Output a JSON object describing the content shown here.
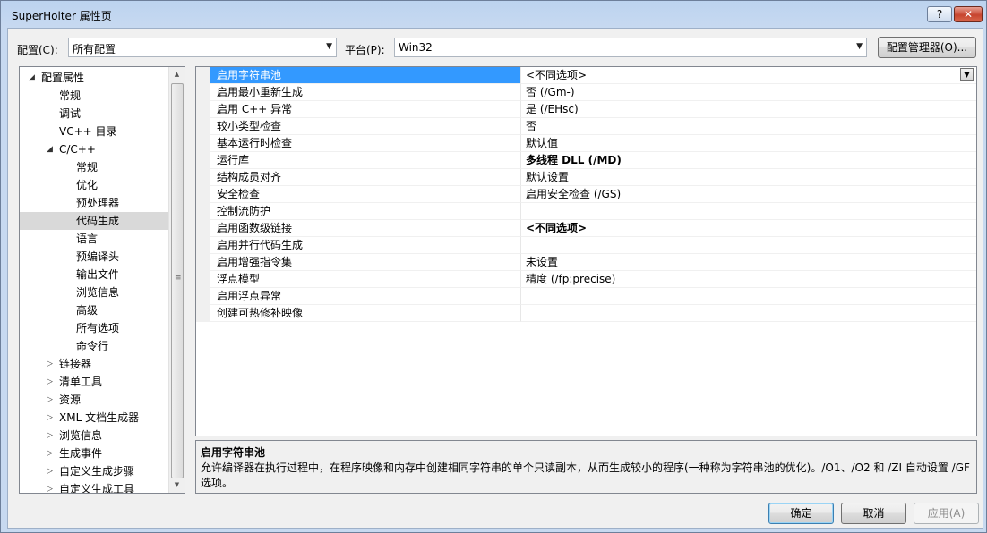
{
  "window": {
    "title": "SuperHolter 属性页",
    "help_label": "?",
    "close_label": "✕"
  },
  "header": {
    "config_label": "配置(C):",
    "config_value": "所有配置",
    "platform_label": "平台(P):",
    "platform_value": "Win32",
    "config_manager_label": "配置管理器(O)..."
  },
  "tree": {
    "items": [
      {
        "label": "配置属性",
        "expander": "◢",
        "level": 0
      },
      {
        "label": "常规",
        "expander": "",
        "level": 1
      },
      {
        "label": "调试",
        "expander": "",
        "level": 1
      },
      {
        "label": "VC++ 目录",
        "expander": "",
        "level": 1
      },
      {
        "label": "C/C++",
        "expander": "◢",
        "level": 1
      },
      {
        "label": "常规",
        "expander": "",
        "level": 2
      },
      {
        "label": "优化",
        "expander": "",
        "level": 2
      },
      {
        "label": "预处理器",
        "expander": "",
        "level": 2
      },
      {
        "label": "代码生成",
        "expander": "",
        "level": 2,
        "selected": true
      },
      {
        "label": "语言",
        "expander": "",
        "level": 2
      },
      {
        "label": "预编译头",
        "expander": "",
        "level": 2
      },
      {
        "label": "输出文件",
        "expander": "",
        "level": 2
      },
      {
        "label": "浏览信息",
        "expander": "",
        "level": 2
      },
      {
        "label": "高级",
        "expander": "",
        "level": 2
      },
      {
        "label": "所有选项",
        "expander": "",
        "level": 2
      },
      {
        "label": "命令行",
        "expander": "",
        "level": 2
      },
      {
        "label": "链接器",
        "expander": "▷",
        "level": 1
      },
      {
        "label": "清单工具",
        "expander": "▷",
        "level": 1
      },
      {
        "label": "资源",
        "expander": "▷",
        "level": 1
      },
      {
        "label": "XML 文档生成器",
        "expander": "▷",
        "level": 1
      },
      {
        "label": "浏览信息",
        "expander": "▷",
        "level": 1
      },
      {
        "label": "生成事件",
        "expander": "▷",
        "level": 1
      },
      {
        "label": "自定义生成步骤",
        "expander": "▷",
        "level": 1
      },
      {
        "label": "自定义生成工具",
        "expander": "▷",
        "level": 1
      }
    ],
    "scroll_up": "▲",
    "scroll_down": "▼",
    "grip": "≡"
  },
  "properties": {
    "rows": [
      {
        "name": "启用字符串池",
        "value": "<不同选项>",
        "bold": false,
        "selected": true
      },
      {
        "name": "启用最小重新生成",
        "value": "否 (/Gm-)",
        "bold": false
      },
      {
        "name": "启用 C++ 异常",
        "value": "是 (/EHsc)",
        "bold": false
      },
      {
        "name": "较小类型检查",
        "value": "否",
        "bold": false
      },
      {
        "name": "基本运行时检查",
        "value": "默认值",
        "bold": false
      },
      {
        "name": "运行库",
        "value": "多线程 DLL (/MD)",
        "bold": true
      },
      {
        "name": "结构成员对齐",
        "value": "默认设置",
        "bold": false
      },
      {
        "name": "安全检查",
        "value": "启用安全检查 (/GS)",
        "bold": false
      },
      {
        "name": "控制流防护",
        "value": "",
        "bold": false
      },
      {
        "name": "启用函数级链接",
        "value": "<不同选项>",
        "bold": true
      },
      {
        "name": "启用并行代码生成",
        "value": "",
        "bold": false
      },
      {
        "name": "启用增强指令集",
        "value": "未设置",
        "bold": false
      },
      {
        "name": "浮点模型",
        "value": "精度 (/fp:precise)",
        "bold": false
      },
      {
        "name": "启用浮点异常",
        "value": "",
        "bold": false
      },
      {
        "name": "创建可热修补映像",
        "value": "",
        "bold": false
      }
    ],
    "dropdown_glyph": "▼"
  },
  "description": {
    "title": "启用字符串池",
    "text": "允许编译器在执行过程中，在程序映像和内存中创建相同字符串的单个只读副本，从而生成较小的程序(一种称为字符串池的优化)。/O1、/O2 和 /ZI 自动设置 /GF 选项。"
  },
  "footer": {
    "ok_label": "确定",
    "cancel_label": "取消",
    "apply_label": "应用(A)"
  },
  "combo_arrow": "▼"
}
